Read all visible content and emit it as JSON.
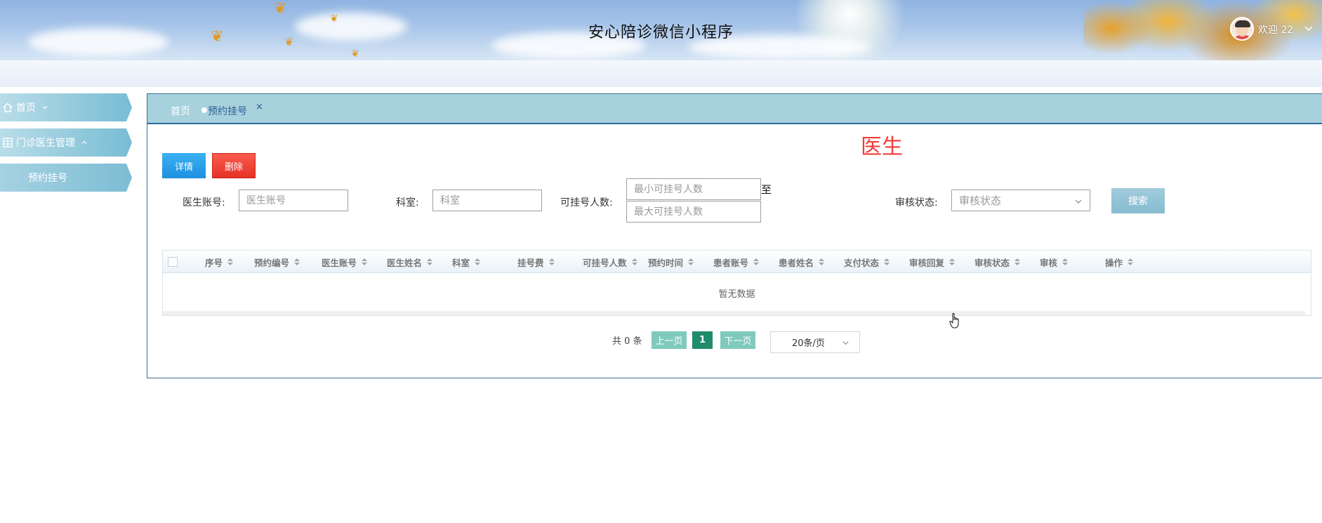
{
  "header": {
    "title": "安心陪诊微信小程序",
    "welcome": "欢迎 22",
    "avatar_icon": "user-avatar-icon",
    "dropdown_icon": "chevron-down-icon"
  },
  "sidebar": {
    "items": [
      {
        "label": "首页",
        "icon": "home-icon",
        "caret": "chevron-down-icon"
      },
      {
        "label": "门诊医生管理",
        "icon": "grid-icon",
        "caret": "chevron-up-icon"
      },
      {
        "label": "预约挂号"
      }
    ]
  },
  "tabs": {
    "home": "首页",
    "active": "预约挂号",
    "close": "×"
  },
  "page_heading": "医生",
  "toolbar": {
    "detail": "详情",
    "delete": "删除"
  },
  "search": {
    "doctor_account_label": "医生账号:",
    "doctor_account_placeholder": "医生账号",
    "department_label": "科室:",
    "department_placeholder": "科室",
    "slots_label": "可挂号人数:",
    "min_slots_placeholder": "最小可挂号人数",
    "max_slots_placeholder": "最大可挂号人数",
    "to_label": "至",
    "review_status_label": "审核状态:",
    "review_status_placeholder": "审核状态",
    "search_button": "搜索"
  },
  "table": {
    "columns": [
      "序号",
      "预约编号",
      "医生账号",
      "医生姓名",
      "科室",
      "挂号费",
      "可挂号人数",
      "预约时间",
      "患者账号",
      "患者姓名",
      "支付状态",
      "审核回复",
      "审核状态",
      "审核",
      "操作"
    ],
    "empty_text": "暂无数据"
  },
  "pagination": {
    "total": "共 0 条",
    "prev": "上一页",
    "current": "1",
    "next": "下一页",
    "page_size": "20条/页"
  },
  "colors": {
    "accent_blue": "#1f90df",
    "danger_red": "#e43224",
    "heading_red": "#f23b3b",
    "pagination_green": "#1f8c6c",
    "tabbar_bg": "#a7d1dc"
  }
}
